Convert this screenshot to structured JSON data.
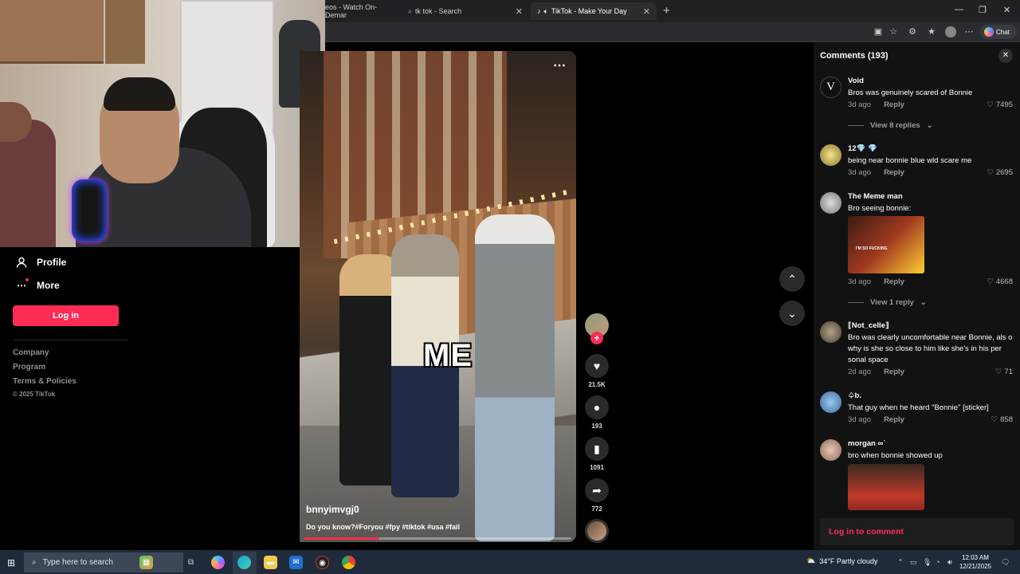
{
  "browser": {
    "tabs": [
      {
        "label": "eos - Watch On-Demar",
        "active": false
      },
      {
        "label": "tk tok - Search",
        "active": false
      },
      {
        "label": "TikTok - Make Your Day",
        "active": true
      }
    ],
    "new_tab_symbol": "+",
    "chat_label": "Chat"
  },
  "leftnav": {
    "items": [
      {
        "label": "Profile",
        "icon": "person-icon"
      },
      {
        "label": "More",
        "icon": "more-dots-icon"
      }
    ],
    "login_label": "Log in",
    "footer_links": [
      "Company",
      "Program",
      "Terms & Policies"
    ],
    "copyright": "© 2025 TikTok"
  },
  "video": {
    "caption_overlay": "ME",
    "username": "bnnyimvgj0",
    "description": "Do you know?#Foryou #fpy #tiktok #usa #fail",
    "progress": 0.28
  },
  "actions": {
    "likes": "21.5K",
    "comments": "193",
    "saves": "1091",
    "shares": "772"
  },
  "comments_panel": {
    "title": "Comments (193)",
    "items": [
      {
        "user": "Void",
        "text": "Bros was genuinely scared of Bonnie",
        "time": "3d ago",
        "likes": "7495",
        "replies": "View 8 replies"
      },
      {
        "user": "12💎 💎",
        "text": "being near bonnie blue wld scare me",
        "time": "3d ago",
        "likes": "2695"
      },
      {
        "user": "The Meme man",
        "text": "Bro seeing bonnie:",
        "time": "3d ago",
        "likes": "4668",
        "replies": "View 1 reply",
        "image_caption": "I'M SO FUCKING"
      },
      {
        "user": "⟦Not_celle⟧",
        "text": "Bro was clearly uncomfortable near Bonnie, als o why is she so close to him like she's in his per sonal space",
        "time": "2d ago",
        "likes": "71"
      },
      {
        "user": "♤b.",
        "text": "That guy when he heard \"Bonnie\" [sticker]",
        "time": "3d ago",
        "likes": "858"
      },
      {
        "user": "morgan ∞ˋ",
        "text": "bro when bonnie showed up"
      }
    ],
    "reply_label": "Reply",
    "login_prompt": "Log in to comment"
  },
  "taskbar": {
    "search_placeholder": "Type here to search",
    "weather": "34°F  Partly cloudy",
    "time": "12:03 AM",
    "date": "12/21/2025"
  },
  "colors": {
    "accent": "#fe2c55",
    "panel_bg": "#121212",
    "taskbar_bg": "#1f2b3a"
  }
}
